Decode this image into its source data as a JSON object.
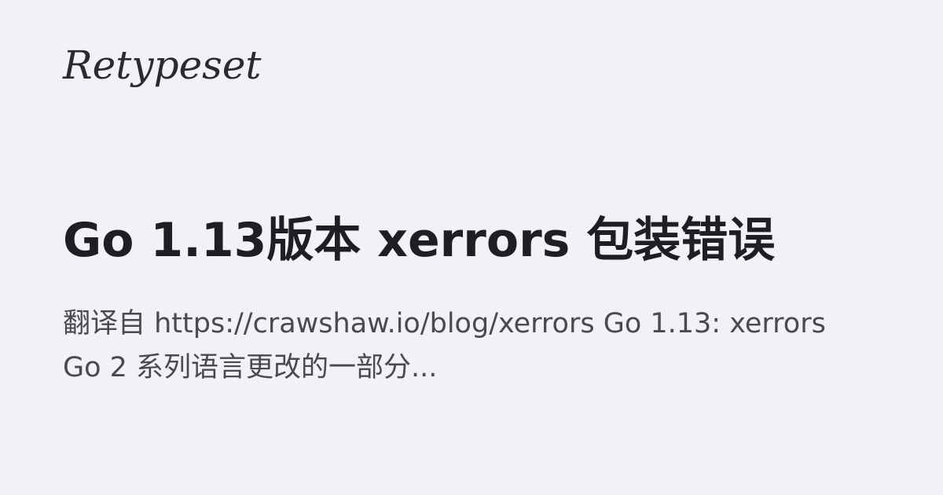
{
  "site": {
    "logo_text": "Retypeset"
  },
  "article": {
    "title": "Go 1.13版本 xerrors 包装错误",
    "description": "翻译自 https://crawshaw.io/blog/xerrors Go 1.13: xerrors Go 2 系列语言更改的一部分..."
  }
}
